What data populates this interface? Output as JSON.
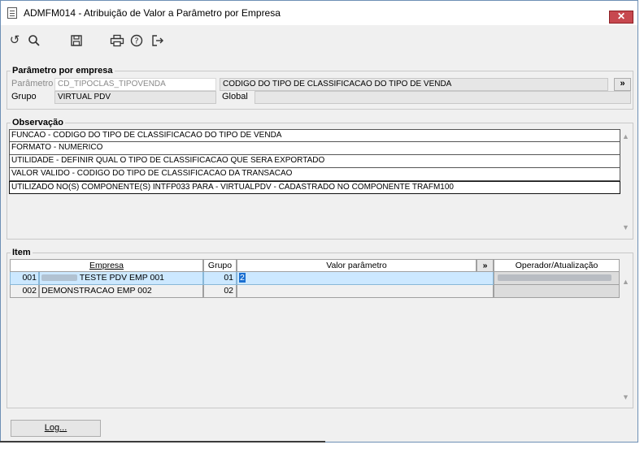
{
  "window": {
    "title": "ADMFM014 - Atribuição de Valor a Parâmetro por Empresa",
    "close_glyph": "✕"
  },
  "toolbar": {
    "icons": [
      "undo-icon",
      "search-icon",
      "save-icon",
      "print-icon",
      "help-icon",
      "exit-icon"
    ]
  },
  "parametro_group": {
    "label": "Parâmetro por empresa",
    "parametro_label": "Parâmetro",
    "parametro_code": "CD_TIPOCLAS_TIPOVENDA",
    "parametro_desc": "CODIGO DO TIPO DE CLASSIFICACAO DO TIPO DE VENDA",
    "expand_label": "»",
    "grupo_label": "Grupo",
    "grupo_value": "VIRTUAL PDV",
    "global_label": "Global",
    "global_value": ""
  },
  "observacao": {
    "label": "Observação",
    "lines": [
      "FUNCAO - CODIGO DO TIPO DE CLASSIFICACAO DO TIPO DE VENDA",
      "FORMATO - NUMERICO",
      "UTILIDADE - DEFINIR QUAL O TIPO DE CLASSIFICACAO QUE SERA EXPORTADO",
      "VALOR VALIDO - CODIGO DO TIPO DE CLASSIFICACAO DA TRANSACAO",
      "UTILIZADO NO(S) COMPONENTE(S) INTFP033  PARA  - VIRTUALPDV - CADASTRADO NO COMPONENTE TRAFM100"
    ]
  },
  "item": {
    "label": "Item",
    "columns": {
      "empresa": "Empresa",
      "grupo": "Grupo",
      "valor": "Valor parâmetro",
      "expand": "»",
      "operador": "Operador/Atualização"
    },
    "rows": [
      {
        "codigo": "001",
        "empresa": "TESTE PDV EMP 001",
        "grupo": "01",
        "valor": "2",
        "selected": true
      },
      {
        "codigo": "002",
        "empresa": "DEMONSTRACAO EMP 002",
        "grupo": "02",
        "valor": "",
        "selected": false
      }
    ]
  },
  "footer": {
    "log_button": "Log..."
  },
  "scroll": {
    "up": "▲",
    "down": "▼"
  }
}
